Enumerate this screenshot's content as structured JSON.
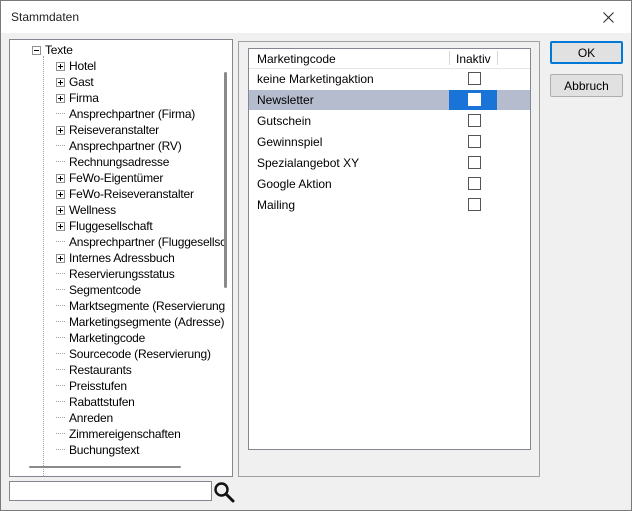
{
  "window": {
    "title": "Stammdaten"
  },
  "tree": {
    "root": "Texte",
    "items": [
      {
        "label": "Hotel",
        "expandable": true
      },
      {
        "label": "Gast",
        "expandable": true
      },
      {
        "label": "Firma",
        "expandable": true
      },
      {
        "label": "Ansprechpartner (Firma)",
        "expandable": false
      },
      {
        "label": "Reiseveranstalter",
        "expandable": true
      },
      {
        "label": "Ansprechpartner (RV)",
        "expandable": false
      },
      {
        "label": "Rechnungsadresse",
        "expandable": false
      },
      {
        "label": "FeWo-Eigentümer",
        "expandable": true
      },
      {
        "label": "FeWo-Reiseveranstalter",
        "expandable": true
      },
      {
        "label": "Wellness",
        "expandable": true
      },
      {
        "label": "Fluggesellschaft",
        "expandable": true
      },
      {
        "label": "Ansprechpartner (Fluggesellsc",
        "expandable": false
      },
      {
        "label": "Internes Adressbuch",
        "expandable": true
      },
      {
        "label": "Reservierungsstatus",
        "expandable": false
      },
      {
        "label": "Segmentcode",
        "expandable": false
      },
      {
        "label": "Marktsegmente (Reservierung",
        "expandable": false
      },
      {
        "label": "Marketingsegmente (Adresse)",
        "expandable": false
      },
      {
        "label": "Marketingcode",
        "expandable": false
      },
      {
        "label": "Sourcecode (Reservierung)",
        "expandable": false
      },
      {
        "label": "Restaurants",
        "expandable": false
      },
      {
        "label": "Preisstufen",
        "expandable": false
      },
      {
        "label": "Rabattstufen",
        "expandable": false
      },
      {
        "label": "Anreden",
        "expandable": false
      },
      {
        "label": "Zimmereigenschaften",
        "expandable": false
      },
      {
        "label": "Buchungstext",
        "expandable": false
      }
    ]
  },
  "search": {
    "value": "",
    "icon": "search-icon"
  },
  "list": {
    "columns": [
      "Marketingcode",
      "Inaktiv"
    ],
    "rows": [
      {
        "code": "keine Marketingaktion",
        "inactive": false,
        "selected": false
      },
      {
        "code": "Newsletter",
        "inactive": false,
        "selected": true
      },
      {
        "code": "Gutschein",
        "inactive": false,
        "selected": false
      },
      {
        "code": "Gewinnspiel",
        "inactive": false,
        "selected": false
      },
      {
        "code": "Spezialangebot XY",
        "inactive": false,
        "selected": false
      },
      {
        "code": "Google Aktion",
        "inactive": false,
        "selected": false
      },
      {
        "code": "Mailing",
        "inactive": false,
        "selected": false
      }
    ]
  },
  "buttons": {
    "ok": "OK",
    "cancel": "Abbruch"
  },
  "colors": {
    "selection_row": "#b4bccd",
    "selection_cell": "#1a73d6",
    "default_button_border": "#0078d7"
  }
}
